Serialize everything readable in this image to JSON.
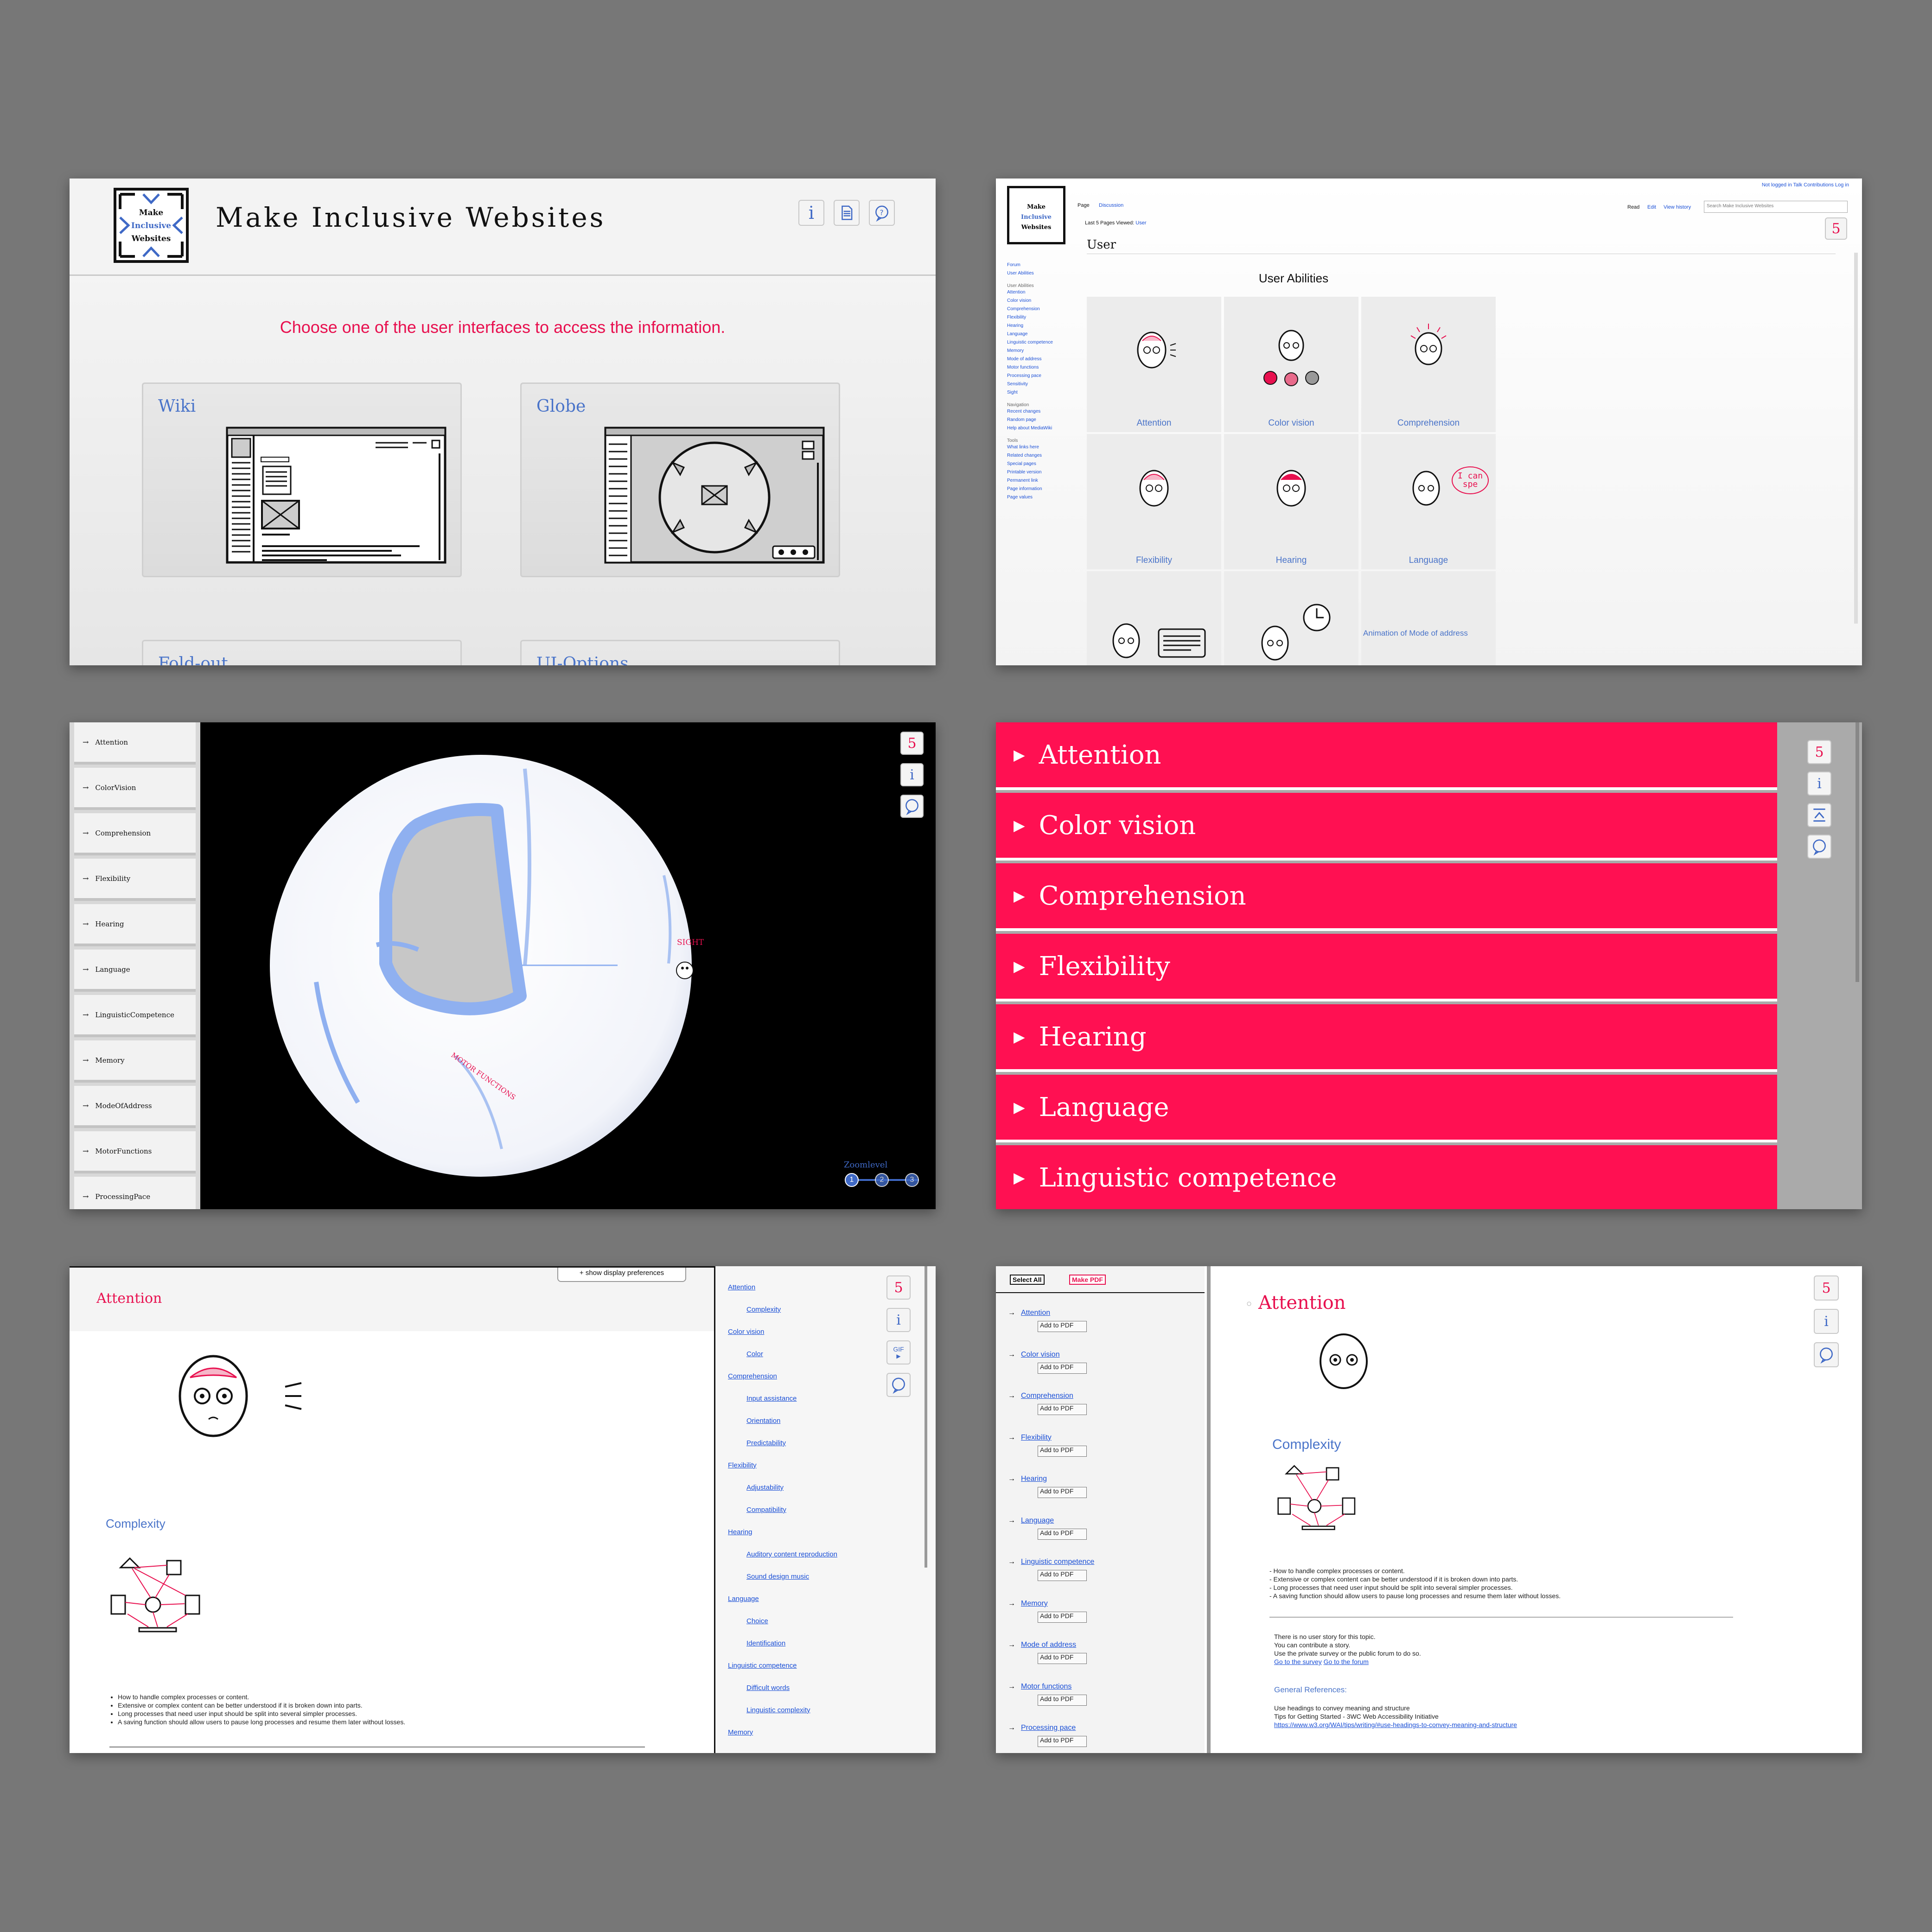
{
  "s1": {
    "logo_lines": [
      "Make",
      "Inclusive",
      "Websites"
    ],
    "title": "Make Inclusive Websites",
    "prompt": "Choose one of the user interfaces to access the information.",
    "cards": [
      "Wiki",
      "Globe",
      "Fold-out",
      "UI-Options"
    ]
  },
  "s2": {
    "top_links": "Not logged in  Talk  Contributions  Log in",
    "tabs": {
      "page": "Page",
      "discussion": "Discussion",
      "read": "Read",
      "edit": "Edit",
      "history": "View history"
    },
    "search_placeholder": "Search Make Inclusive Websites",
    "breadcrumb_prefix": "Last 5 Pages Viewed:",
    "breadcrumb_link": "User",
    "page_title": "User",
    "section_heading": "User Abilities",
    "side_top": [
      "Forum",
      "User Abilities"
    ],
    "side_abilities_head": "User Abilities",
    "side_abilities": [
      "Attention",
      "Color vision",
      "Comprehension",
      "Flexibility",
      "Hearing",
      "Language",
      "Linguistic competence",
      "Memory",
      "Mode of address",
      "Motor functions",
      "Processing pace",
      "Sensitivity",
      "Sight"
    ],
    "side_nav_head": "Navigation",
    "side_nav": [
      "Recent changes",
      "Random page",
      "Help about MediaWiki"
    ],
    "side_tools_head": "Tools",
    "side_tools": [
      "What links here",
      "Related changes",
      "Special pages",
      "Printable version",
      "Permanent link",
      "Page information",
      "Page values"
    ],
    "cells": [
      "Attention",
      "Color vision",
      "Comprehension",
      "Flexibility",
      "Hearing",
      "Language"
    ],
    "speech": "I can spe",
    "broken_img": "Animation of Mode of address"
  },
  "s3": {
    "nav": [
      "Attention",
      "ColorVision",
      "Comprehension",
      "Flexibility",
      "Hearing",
      "Language",
      "LinguisticCompetence",
      "Memory",
      "ModeOfAddress",
      "MotorFunctions",
      "ProcessingPace"
    ],
    "globe_labels": [
      "SIGHT",
      "MOTOR FUNCTIONS"
    ],
    "zoom_label": "Zoomlevel",
    "zoom_levels": [
      "1",
      "2",
      "3"
    ]
  },
  "s4": {
    "items": [
      "Attention",
      "Color vision",
      "Comprehension",
      "Flexibility",
      "Hearing",
      "Language",
      "Linguistic competence"
    ]
  },
  "s5": {
    "prefs_button": "+ show display preferences",
    "heading": "Attention",
    "sub_heading": "Complexity",
    "bullets": [
      "How to handle complex processes or content.",
      "Extensive or complex content can be better understood if it is broken down into parts.",
      "Long processes that need user input should be split into several simpler processes.",
      "A saving function should allow users to pause long processes and resume them later without losses."
    ],
    "toc": [
      {
        "t": "Attention",
        "sub": false
      },
      {
        "t": "Complexity",
        "sub": true
      },
      {
        "t": "Color vision",
        "sub": false
      },
      {
        "t": "Color",
        "sub": true
      },
      {
        "t": "Comprehension",
        "sub": false
      },
      {
        "t": "Input assistance",
        "sub": true
      },
      {
        "t": "Orientation",
        "sub": true
      },
      {
        "t": "Predictability",
        "sub": true
      },
      {
        "t": "Flexibility",
        "sub": false
      },
      {
        "t": "Adjustability",
        "sub": true
      },
      {
        "t": "Compatibility",
        "sub": true
      },
      {
        "t": "Hearing",
        "sub": false
      },
      {
        "t": "Auditory content reproduction",
        "sub": true
      },
      {
        "t": "Sound design music",
        "sub": true
      },
      {
        "t": "Language",
        "sub": false
      },
      {
        "t": "Choice",
        "sub": true
      },
      {
        "t": "Identification",
        "sub": true
      },
      {
        "t": "Linguistic competence",
        "sub": false
      },
      {
        "t": "Difficult words",
        "sub": true
      },
      {
        "t": "Linguistic complexity",
        "sub": true
      },
      {
        "t": "Memory",
        "sub": false
      }
    ],
    "gif_label": "GIF"
  },
  "s6": {
    "select_all": "Select All",
    "make_pdf": "Make PDF",
    "items": [
      "Attention",
      "Color vision",
      "Comprehension",
      "Flexibility",
      "Hearing",
      "Language",
      "Linguistic competence",
      "Memory",
      "Mode of address",
      "Motor functions",
      "Processing pace"
    ],
    "add_label": "Add to PDF",
    "heading": "Attention",
    "sub_heading": "Complexity",
    "bullets": [
      "- How to handle complex processes or content.",
      "- Extensive or complex content can be better understood if it is broken down into parts.",
      "- Long processes that need user input should be split into several simpler processes.",
      "- A saving function should allow users to pause long processes and resume them later without losses."
    ],
    "story_lines": [
      "There is no user story for this topic.",
      "You can contribute a story.",
      "Use the private survey or the public forum to do so."
    ],
    "survey_link": "Go to the survey",
    "forum_link": "Go to the forum",
    "refs_heading": "General References:",
    "ref_lines": [
      "Use headings to convey meaning and structure",
      "Tips for Getting Started - 3WC Web Accessibility Initiative"
    ],
    "ref_url": "https://www.w3.org/WAI/tips/writing/#use-headings-to-convey-meaning-and-structure"
  },
  "colors": {
    "accent": "#e8104f",
    "link": "#1a4fd6",
    "heading_blue": "#4a74c9",
    "foldout_red": "#ff1052"
  },
  "icons": [
    "info-icon",
    "document-icon",
    "chat-question-icon",
    "html5-icon",
    "layers-icon",
    "arrow-right-icon"
  ]
}
